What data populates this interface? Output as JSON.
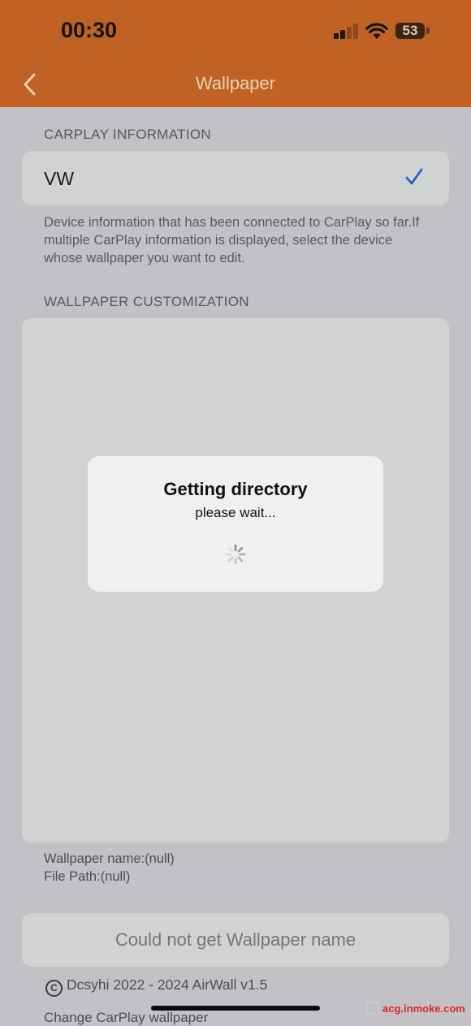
{
  "status_bar": {
    "time": "00:30",
    "battery": "53",
    "icons": [
      "cellular-signal-icon",
      "wifi-icon",
      "battery-icon"
    ]
  },
  "nav": {
    "title": "Wallpaper",
    "back_icon": "chevron-left-icon",
    "background_color": "#bf6223"
  },
  "carplay": {
    "header": "CARPLAY INFORMATION",
    "device": "VW",
    "selected": true,
    "check_color": "#1f63c8",
    "info": "Device information that has been connected to CarPlay so far.If multiple CarPlay information is displayed, select the device whose wallpaper you want to edit."
  },
  "customization": {
    "header": "WALLPAPER CUSTOMIZATION",
    "wallpaper_name": "Wallpaper name:(null)",
    "file_path": "File Path:(null)",
    "button_label": "Could not get Wallpaper name"
  },
  "footer": {
    "copyright": "Dcsyhi 2022 - 2024 AirWall v1.5",
    "next_label": "Change CarPlay wallpaper"
  },
  "dialog": {
    "title": "Getting directory",
    "message": "please wait..."
  },
  "watermark": "acg.inmoke.com"
}
